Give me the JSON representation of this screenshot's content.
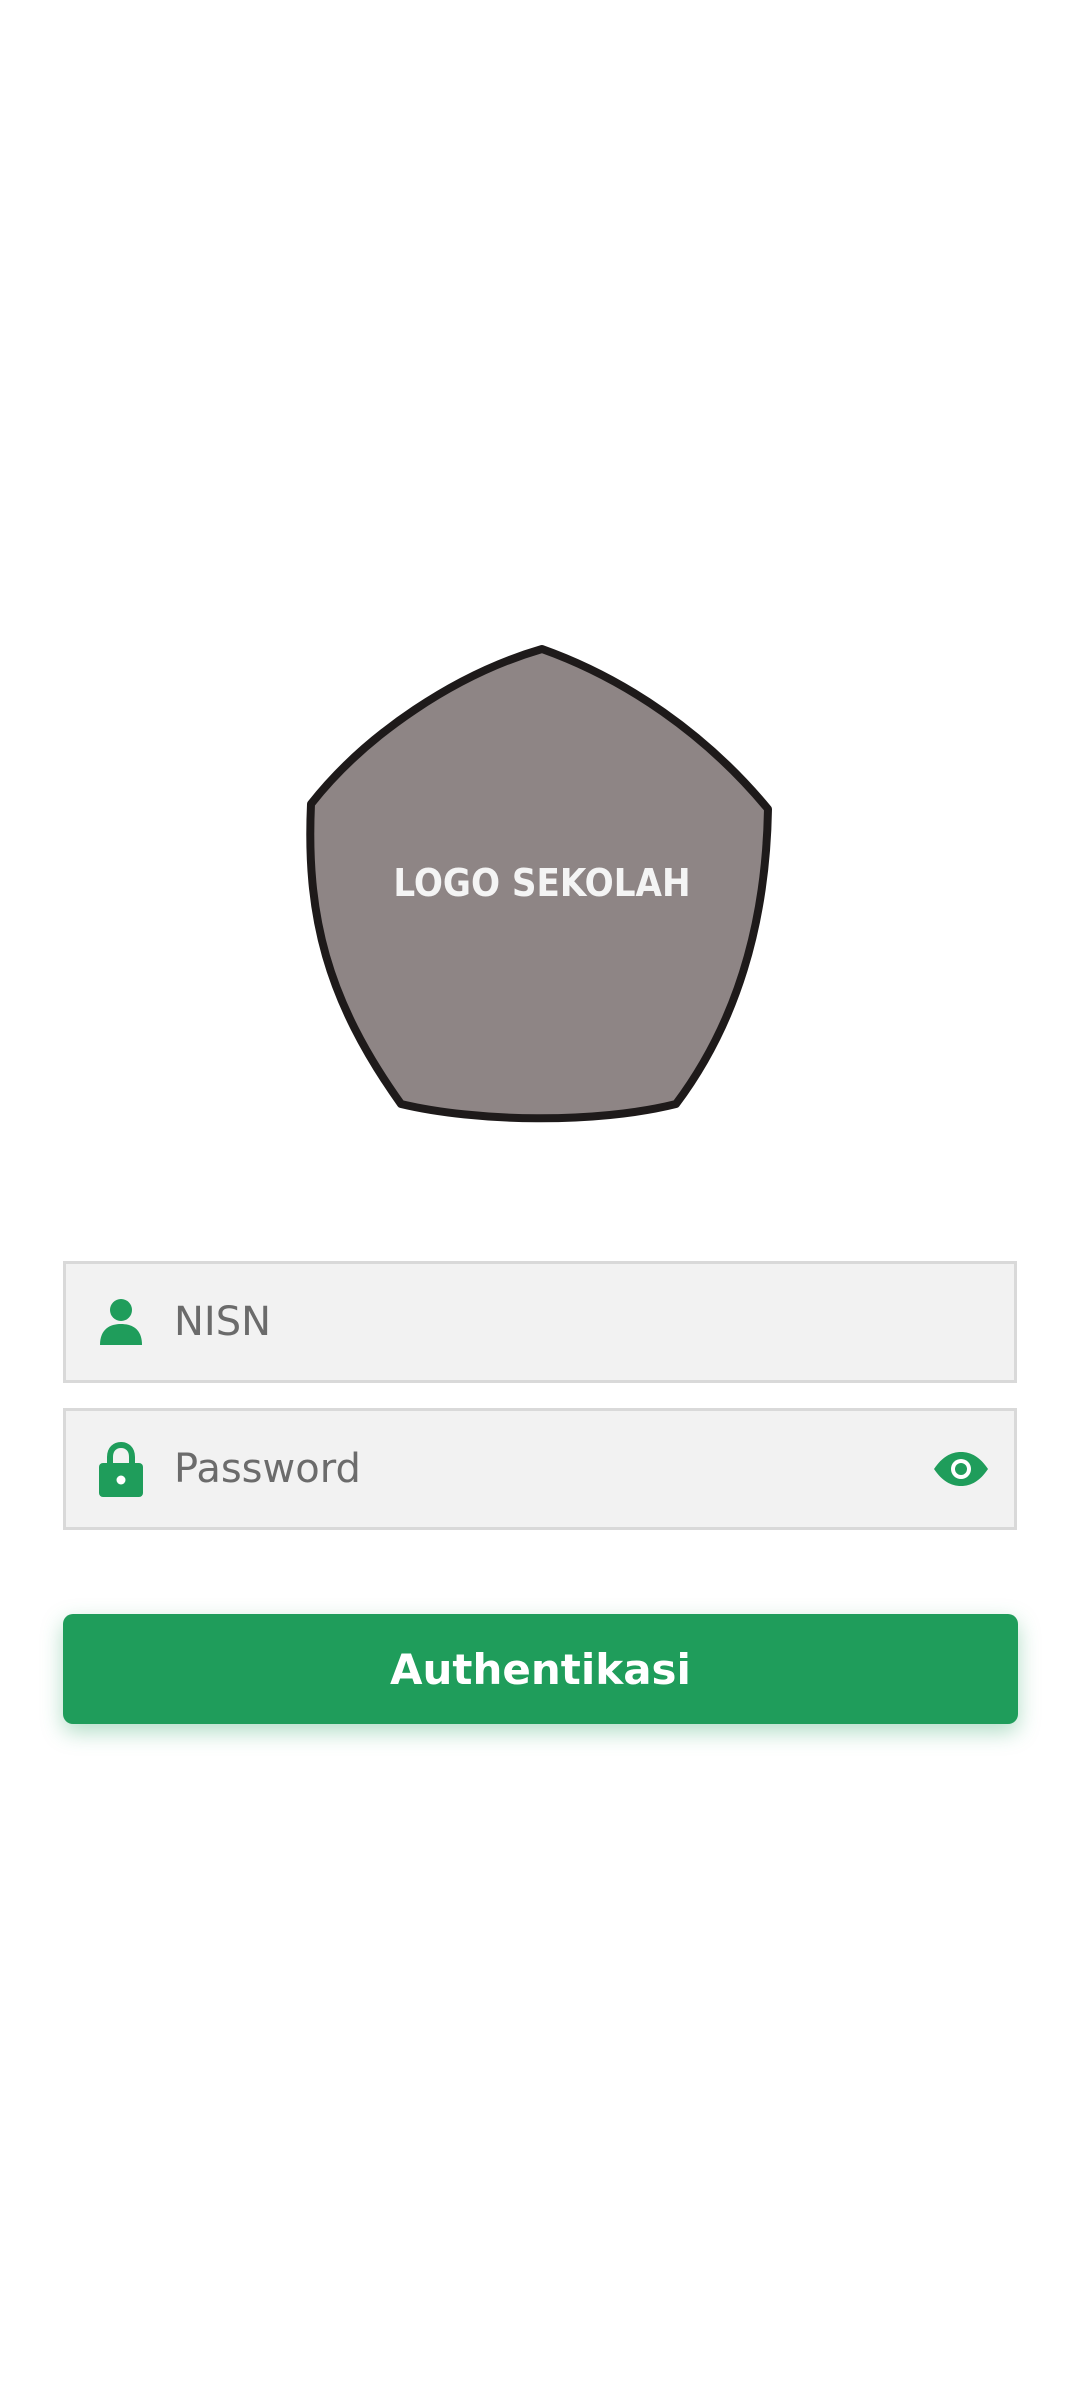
{
  "logo": {
    "text": "LOGO SEKOLAH",
    "fill_color": "#8e8585",
    "stroke_color": "#1e1a1a"
  },
  "form": {
    "nisn": {
      "placeholder": "NISN",
      "value": "",
      "icon": "person-icon"
    },
    "password": {
      "placeholder": "Password",
      "value": "",
      "icon": "lock-icon",
      "toggle_icon": "eye-icon"
    },
    "submit_label": "Authentikasi"
  },
  "colors": {
    "accent": "#1f9d5b",
    "field_background": "#f2f2f2",
    "field_border": "#d9d9d9",
    "placeholder": "#6b6b6b"
  }
}
